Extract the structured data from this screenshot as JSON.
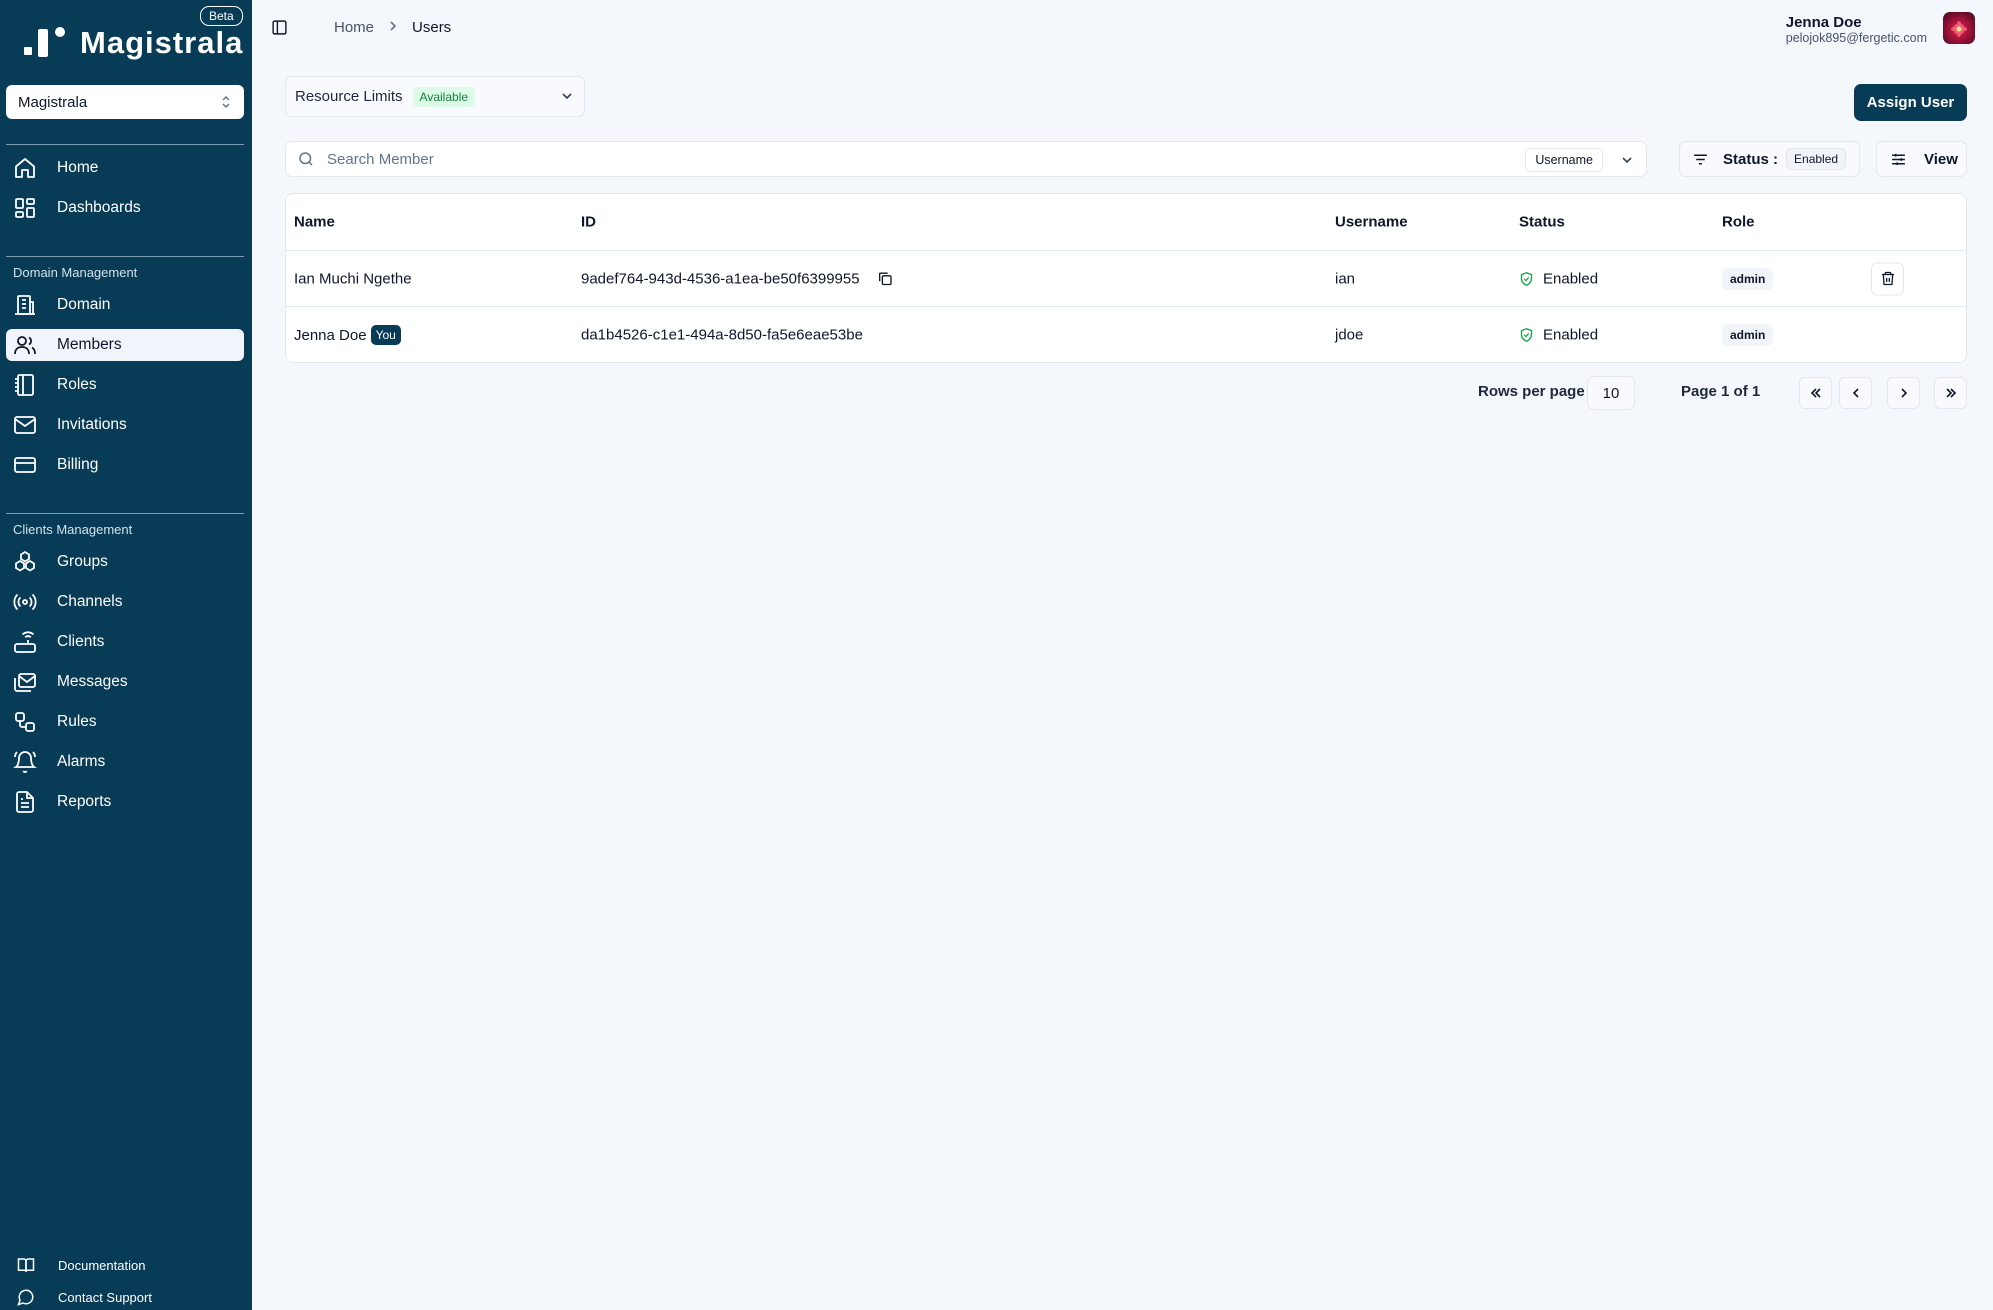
{
  "sidebar": {
    "brand": "Magistrala",
    "beta": "Beta",
    "workspace": "Magistrala",
    "top_items": [
      {
        "label": "Home",
        "icon": "home-icon"
      },
      {
        "label": "Dashboards",
        "icon": "dashboard-icon"
      }
    ],
    "domain_section": "Domain Management",
    "domain_items": [
      {
        "label": "Domain",
        "icon": "building-icon"
      },
      {
        "label": "Members",
        "icon": "users-icon",
        "active": true
      },
      {
        "label": "Roles",
        "icon": "notebook-icon"
      },
      {
        "label": "Invitations",
        "icon": "mail-icon"
      },
      {
        "label": "Billing",
        "icon": "credit-card-icon"
      }
    ],
    "clients_section": "Clients Management",
    "client_items": [
      {
        "label": "Groups",
        "icon": "boxes-icon"
      },
      {
        "label": "Channels",
        "icon": "radio-icon"
      },
      {
        "label": "Clients",
        "icon": "router-icon"
      },
      {
        "label": "Messages",
        "icon": "mails-icon"
      },
      {
        "label": "Rules",
        "icon": "workflow-icon"
      },
      {
        "label": "Alarms",
        "icon": "bell-ring-icon"
      },
      {
        "label": "Reports",
        "icon": "file-text-icon"
      }
    ],
    "footer_items": [
      {
        "label": "Documentation",
        "icon": "book-icon"
      },
      {
        "label": "Contact Support",
        "icon": "message-circle-icon"
      }
    ]
  },
  "header": {
    "breadcrumb": [
      "Home",
      "Users"
    ],
    "user_name": "Jenna Doe",
    "user_email": "pelojok895@fergetic.com"
  },
  "toolbar": {
    "resource_limits": "Resource Limits",
    "resource_status": "Available",
    "assign_user": "Assign User",
    "search_placeholder": "Search Member",
    "search_type": "Username",
    "status_label": "Status :",
    "status_value": "Enabled",
    "view_label": "View"
  },
  "table": {
    "columns": [
      "Name",
      "ID",
      "Username",
      "Status",
      "Role"
    ],
    "rows": [
      {
        "name": "Ian Muchi Ngethe",
        "id": "9adef764-943d-4536-a1ea-be50f6399955",
        "username": "ian",
        "status": "Enabled",
        "role": "admin"
      },
      {
        "name": "Jenna Doe",
        "you": "You",
        "id": "da1b4526-c1e1-494a-8d50-fa5e6eae53be",
        "username": "jdoe",
        "status": "Enabled",
        "role": "admin"
      }
    ]
  },
  "pagination": {
    "rows_per_page_label": "Rows per page",
    "rows_per_page": "10",
    "page_label": "Page 1 of 1"
  },
  "colors": {
    "sidebar_bg": "#073b56",
    "primary": "#073b56",
    "page_bg": "#f4f7fc",
    "status_green": "#16a34a"
  }
}
